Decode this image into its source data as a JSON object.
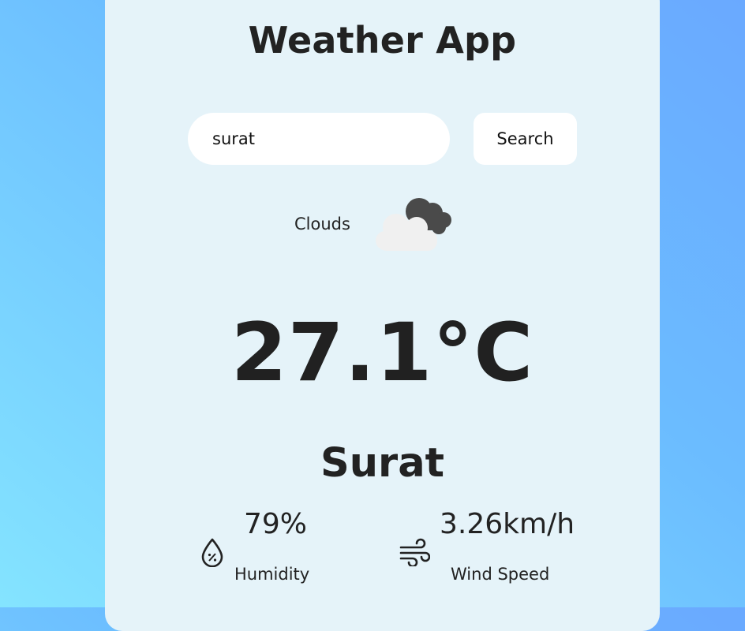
{
  "app": {
    "title": "Weather App"
  },
  "search": {
    "value": "surat",
    "placeholder": "",
    "button_label": "Search"
  },
  "weather": {
    "condition": "Clouds",
    "condition_icon": "clouds-icon",
    "temperature": "27.1°C",
    "city": "Surat",
    "humidity_value": "79%",
    "humidity_label": "Humidity",
    "wind_value": "3.26km/h",
    "wind_label": "Wind Speed"
  },
  "colors": {
    "card_bg": "#e5f3f9",
    "gradient_top": "#6aa9ff",
    "gradient_bottom": "#84e4ff",
    "text": "#222222"
  }
}
